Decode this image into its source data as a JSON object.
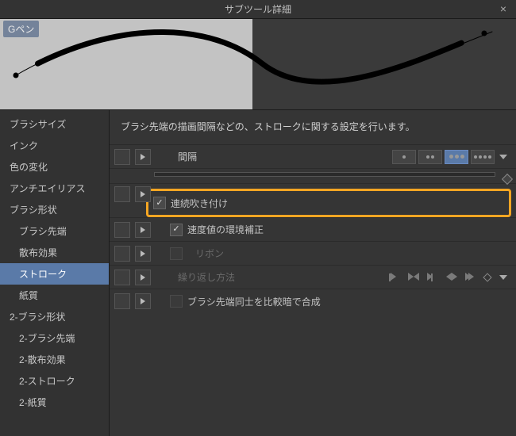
{
  "titlebar": {
    "title": "サブツール詳細"
  },
  "preview": {
    "tool_name": "Gペン"
  },
  "sidebar": {
    "items": [
      {
        "label": "ブラシサイズ",
        "indent": false,
        "selected": false
      },
      {
        "label": "インク",
        "indent": false,
        "selected": false
      },
      {
        "label": "色の変化",
        "indent": false,
        "selected": false
      },
      {
        "label": "アンチエイリアス",
        "indent": false,
        "selected": false
      },
      {
        "label": "ブラシ形状",
        "indent": false,
        "selected": false
      },
      {
        "label": "ブラシ先端",
        "indent": true,
        "selected": false
      },
      {
        "label": "散布効果",
        "indent": true,
        "selected": false
      },
      {
        "label": "ストローク",
        "indent": true,
        "selected": true
      },
      {
        "label": "紙質",
        "indent": true,
        "selected": false
      },
      {
        "label": "2-ブラシ形状",
        "indent": false,
        "selected": false
      },
      {
        "label": "2-ブラシ先端",
        "indent": true,
        "selected": false
      },
      {
        "label": "2-散布効果",
        "indent": true,
        "selected": false
      },
      {
        "label": "2-ストローク",
        "indent": true,
        "selected": false
      },
      {
        "label": "2-紙質",
        "indent": true,
        "selected": false
      }
    ]
  },
  "content": {
    "description": "ブラシ先端の描画間隔などの、ストロークに関する設定を行います。",
    "rows": {
      "spacing": {
        "label": "間隔"
      },
      "continuous": {
        "label": "連続吹き付け",
        "checked": true
      },
      "velocity": {
        "label": "速度値の環境補正",
        "checked": true
      },
      "ribbon": {
        "label": "リボン",
        "checked": false
      },
      "repeat": {
        "label": "繰り返し方法"
      },
      "compare": {
        "label": "ブラシ先端同士を比較暗で合成",
        "checked": false
      }
    }
  }
}
